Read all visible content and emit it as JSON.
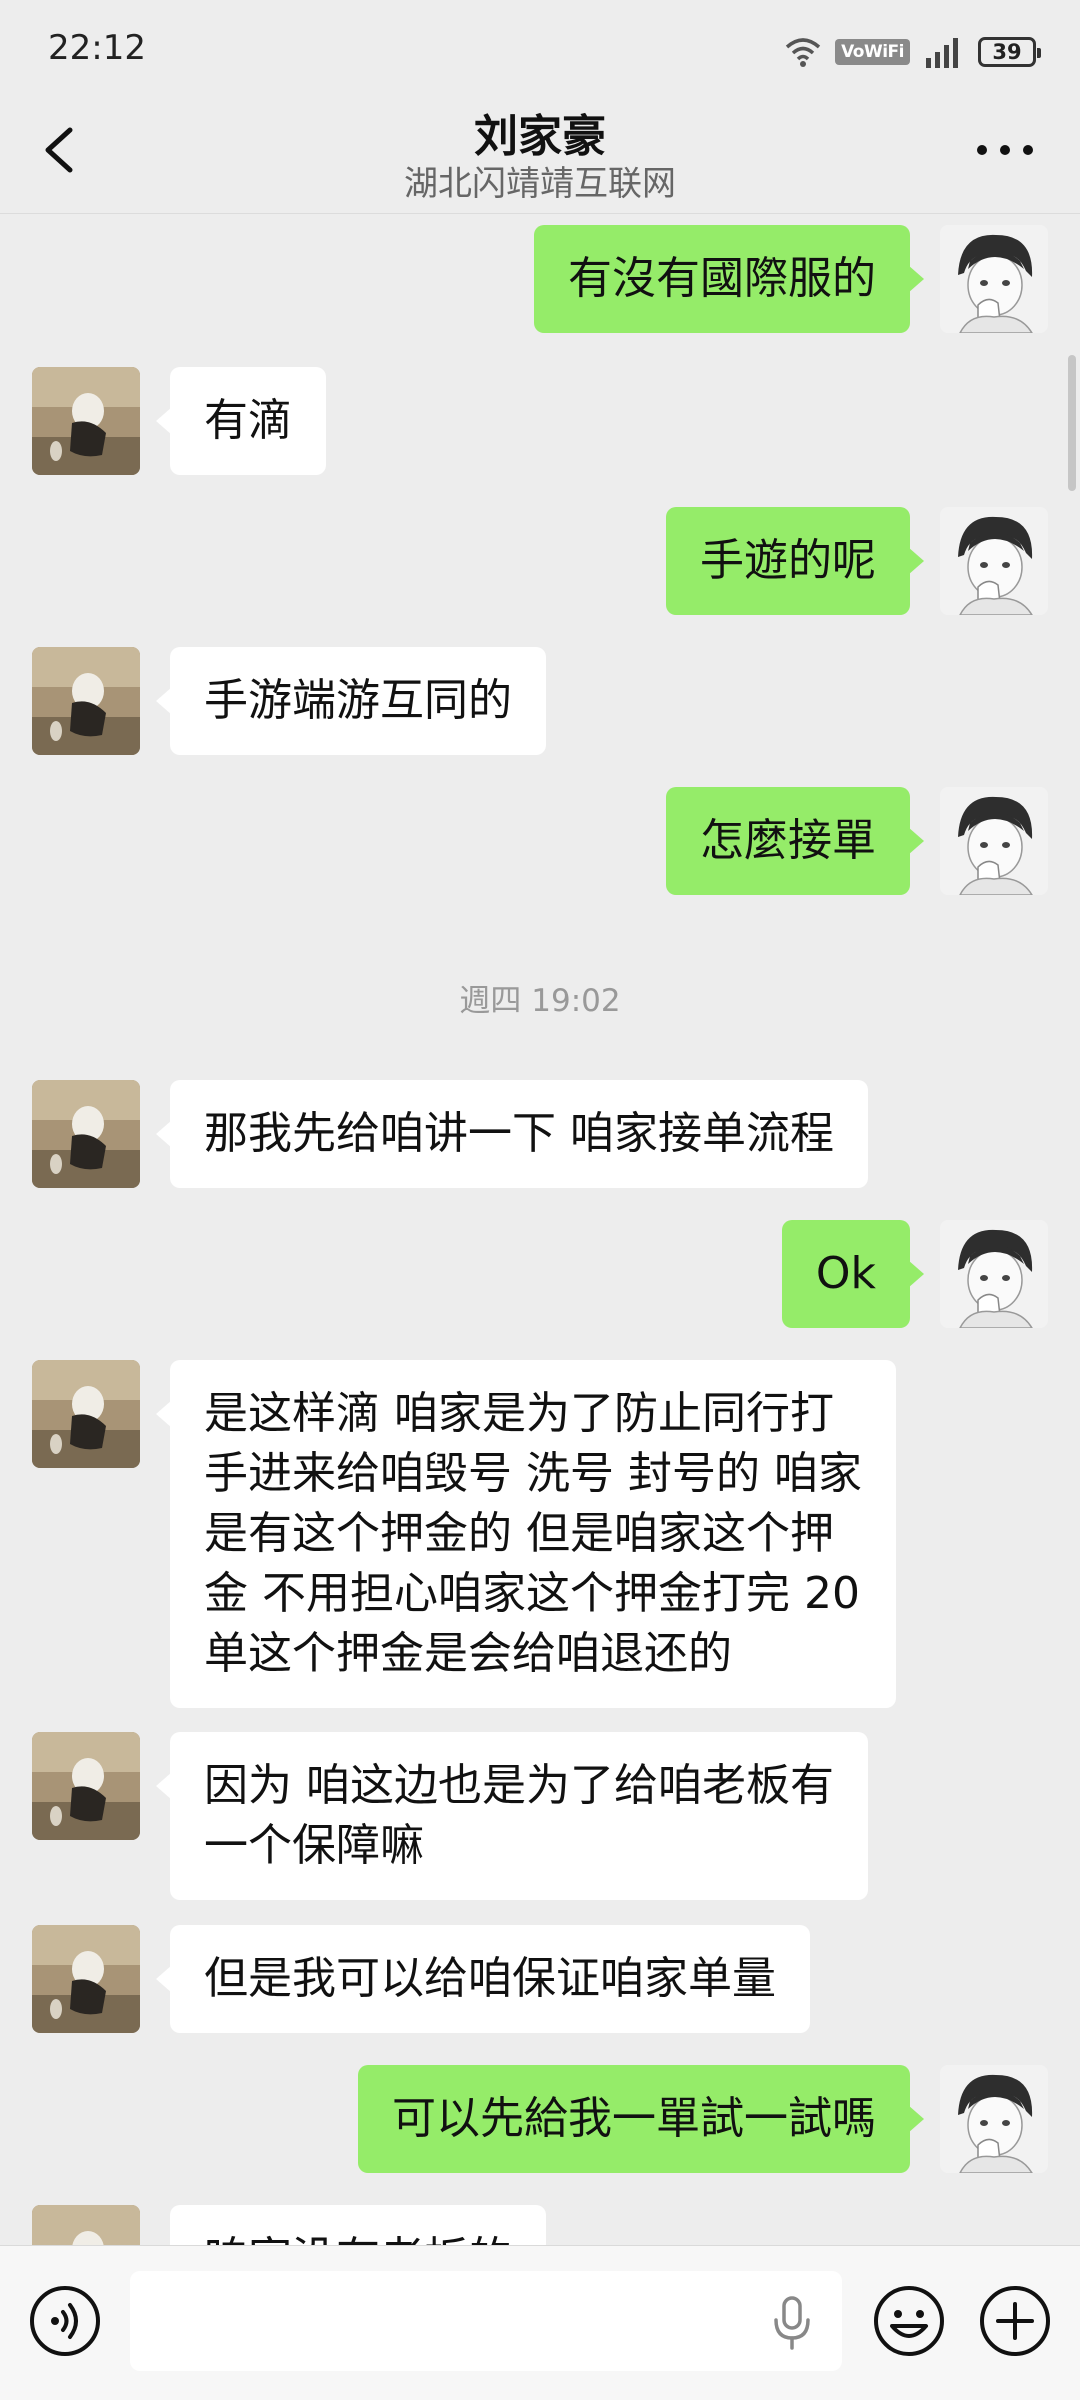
{
  "status_bar": {
    "time": "22:12",
    "vowifi_label": "VoWiFi",
    "battery": "39"
  },
  "header": {
    "title": "刘家豪",
    "subtitle": "湖北闪靖靖互联网"
  },
  "messages": [
    {
      "side": "right",
      "text": "有沒有國際服的"
    },
    {
      "side": "left",
      "text": "有滴"
    },
    {
      "side": "right",
      "text": "手遊的呢"
    },
    {
      "side": "left",
      "text": "手游端游互同的"
    },
    {
      "side": "right",
      "text": "怎麼接單"
    },
    {
      "timestamp": "週四 19:02"
    },
    {
      "side": "left",
      "text": "那我先给咱讲一下 咱家接单流程"
    },
    {
      "side": "right",
      "text": "Ok"
    },
    {
      "side": "left",
      "text": "是这样滴 咱家是为了防止同行打\n手进来给咱毁号 洗号 封号的 咱家\n是有这个押金的 但是咱家这个押\n金 不用担心咱家这个押金打完 20\n单这个押金是会给咱退还的"
    },
    {
      "side": "left",
      "text": "因为 咱这边也是为了给咱老板有\n一个保障嘛"
    },
    {
      "side": "left",
      "text": "但是我可以给咱保证咱家单量"
    },
    {
      "side": "right",
      "text": "可以先給我一單試一試嗎"
    },
    {
      "side": "left",
      "text": "咱家没有老板的"
    }
  ],
  "colors": {
    "background": "#ededed",
    "bubble_self": "#95ec69",
    "bubble_other": "#ffffff"
  }
}
